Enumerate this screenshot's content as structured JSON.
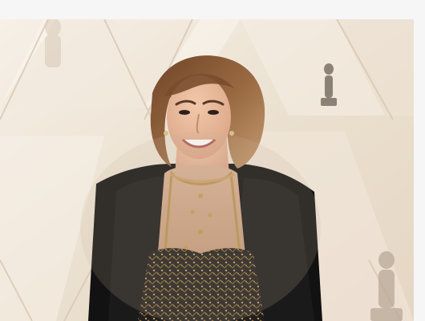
{
  "photo": {
    "subject": "woman-red-carpet",
    "background": "statuette-wall",
    "colors": {
      "backdrop": "#efe6da",
      "backdrop_shadow": "#d9c9b4",
      "hair": "#8a5a35",
      "skin": "#e6b696",
      "jacket": "#151515",
      "sheer_top": "#c79d78",
      "embroidery": "#b8914d"
    }
  }
}
